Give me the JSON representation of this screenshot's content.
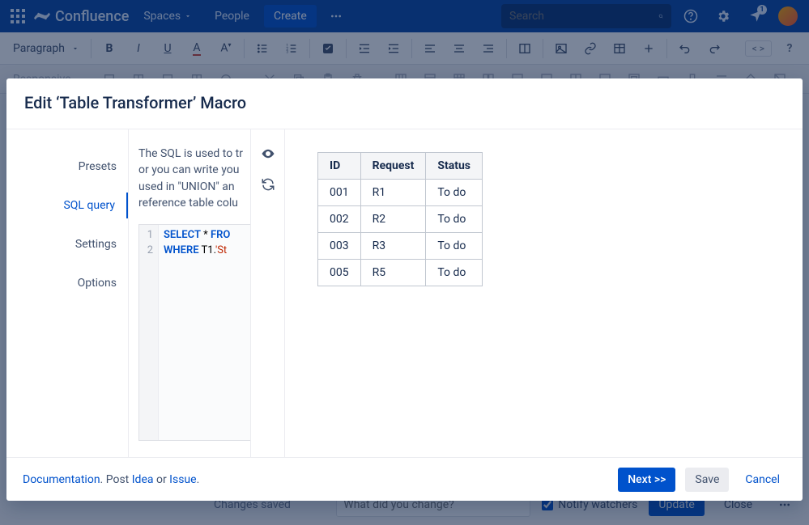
{
  "header": {
    "brand": "Confluence",
    "spaces": "Spaces",
    "people": "People",
    "create": "Create",
    "search_placeholder": "Search",
    "notifications": "1"
  },
  "editor": {
    "style_selector": "Paragraph",
    "responsive": "Responsive"
  },
  "bottom": {
    "changes_saved": "Changes saved",
    "change_placeholder": "What did you change?",
    "notify_label": "Notify watchers",
    "update": "Update",
    "close": "Close"
  },
  "modal": {
    "title": "Edit ‘Table Transformer’ Macro",
    "tabs": [
      "Presets",
      "SQL query",
      "Settings",
      "Options"
    ],
    "active_tab": 1,
    "sql_description": "The SQL is used to transform tables. You can pick the most suitable predefined SQL query from the corresponding drop-down menu or you can write your own SQL queries. Please use T1, T2, etc. as table names. Table names can be used in \"UNION\" and other statements. To reference table columns …",
    "sql_description_visible": "The SQL is used to tr\nor you can write you\nused in \"UNION\" an\nreference table colu",
    "sql_lines": [
      {
        "n": "1",
        "prefix_kw": "SELECT",
        "mid": " * ",
        "suffix_kw": "FRO"
      },
      {
        "n": "2",
        "prefix_kw": "WHERE",
        "mid": " T1.",
        "str": "'St"
      }
    ],
    "footer": {
      "documentation": "Documentation",
      "post": " Post ",
      "idea": "Idea",
      "or": " or ",
      "issue": "Issue",
      "period": ".",
      "next": "Next >>",
      "save": "Save",
      "cancel": "Cancel"
    }
  },
  "preview_table": {
    "headers": [
      "ID",
      "Request",
      "Status"
    ],
    "rows": [
      [
        "001",
        "R1",
        "To do"
      ],
      [
        "002",
        "R2",
        "To do"
      ],
      [
        "003",
        "R3",
        "To do"
      ],
      [
        "005",
        "R5",
        "To do"
      ]
    ]
  }
}
